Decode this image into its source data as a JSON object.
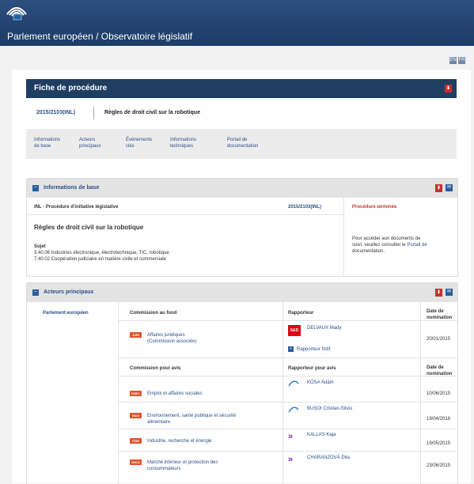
{
  "header": {
    "title": "Parlement européen / Observatoire législatif"
  },
  "languages": [
    "EN",
    "FR"
  ],
  "fiche": {
    "title": "Fiche de procédure",
    "reference": "2015/2103(INL)",
    "procedure_title": "Règles de droit civil sur la robotique"
  },
  "tabs": [
    {
      "line1": "Informations",
      "line2": "de base"
    },
    {
      "line1": "Acteurs",
      "line2": "principaux"
    },
    {
      "line1": "Événements",
      "line2": "clés"
    },
    {
      "line1": "Informations",
      "line2": "techniques"
    },
    {
      "line1": "Portail de",
      "line2": "documentation"
    }
  ],
  "basic_info": {
    "section_title": "Informations de base",
    "procedure_type": "INL - Procédure d'initiative législative",
    "reference": "2015/2103(INL)",
    "status": "Procédure terminée",
    "title": "Règles de droit civil sur la robotique",
    "subject_label": "Sujet",
    "subject_lines": [
      "3.40.06 Industries électronique, électrotechnique, TIC, robotique",
      "7.40.02 Coopération judiciaire en matière civile et commerciale"
    ],
    "follow_up_lines": [
      "Pour accéder aux documents de",
      "suivi, veuillez consulter le",
      "documentation."
    ],
    "follow_up_link": "Portail de"
  },
  "actors": {
    "section_title": "Acteurs principaux",
    "institution": "Parlement européen",
    "col_committee": "Commission au fond",
    "col_rapporteur": "Rapporteur",
    "col_date": [
      "Date de",
      "nomination"
    ],
    "lead_committee": {
      "badge": "JURI",
      "name_lines": [
        "Affaires juridiques",
        "(Commission associée)"
      ],
      "rapporteur": "DELVAUX Mady",
      "group": "S&D",
      "shadow_label": "Rapporteur fictif",
      "date": "20/01/2015"
    },
    "col_opinion": "Commission pour avis",
    "col_opinion_rapporteur": "Rapporteur pour avis",
    "opinions": [
      {
        "badge": "EMPL",
        "name_lines": [
          "Emploi et affaires sociales"
        ],
        "rapporteur": "KÓSA Ádám",
        "date": "10/06/2015"
      },
      {
        "badge": "ENVI",
        "name_lines": [
          "Environnement, santé publique et sécurité",
          "alimentaire"
        ],
        "rapporteur": "BUȘOI Cristian-Silviu",
        "date": "19/04/2016"
      },
      {
        "badge": "ITRE",
        "name_lines": [
          "Industrie, recherche et énergie"
        ],
        "rapporteur": "KALLAS Kaja",
        "date": "19/05/2015"
      },
      {
        "badge": "IMCO",
        "name_lines": [
          "Marché intérieur et protection des",
          "consommateurs"
        ],
        "rapporteur": "CHARANZOVÁ Dita",
        "date": "23/06/2015"
      }
    ]
  },
  "colors": {
    "navy": "#203e62",
    "accent": "#c9302c",
    "badge": "#e0532b",
    "link": "#2a4f88"
  }
}
